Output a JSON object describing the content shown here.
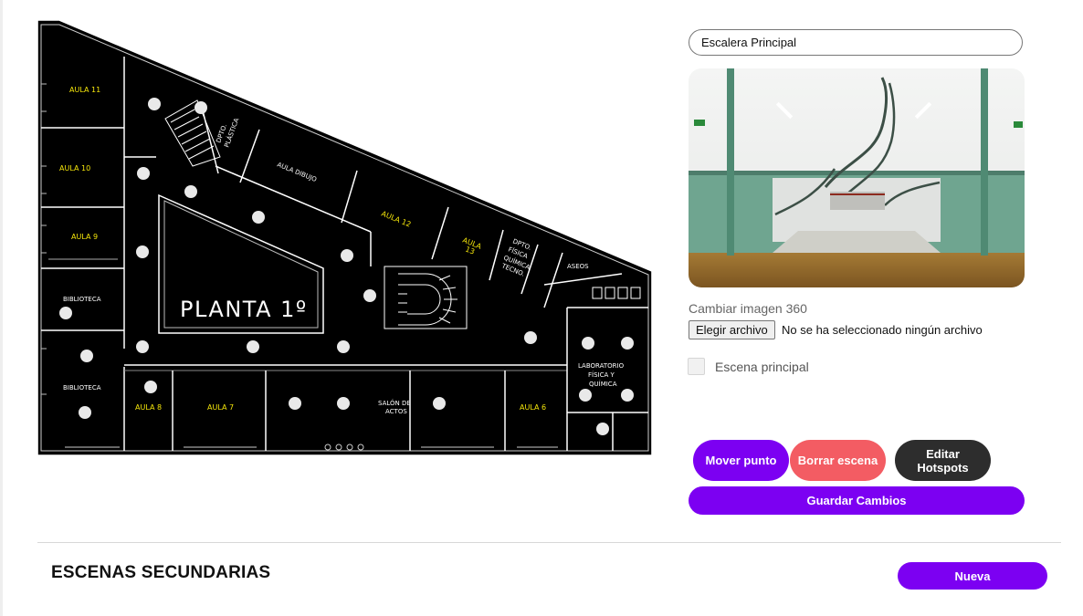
{
  "floorplan": {
    "title": "PLANTA 1º",
    "rooms": {
      "aula11": "AULA 11",
      "aula10": "AULA 10",
      "aula9": "AULA 9",
      "biblioteca1": "BIBLIOTECA",
      "biblioteca2": "BIBLIOTECA",
      "aula8": "AULA 8",
      "aula7": "AULA 7",
      "salon1": "SALÓN DE",
      "salon2": "ACTOS",
      "aula6": "AULA 6",
      "lab1": "LABORATORIO",
      "lab2": "FÍSICA Y",
      "lab3": "QUÍMICA",
      "aseos": "ASEOS",
      "aula12": "AULA 12",
      "aula13a": "AULA",
      "aula13b": "13",
      "dibujo": "AULA DIBUJO",
      "plastica1": "DPTO.",
      "plastica2": "PLÁSTICA",
      "fq1": "DPTO.",
      "fq2": "FÍSICA",
      "fq3": "QUÍMICA",
      "fq4": "TECNO."
    }
  },
  "scene": {
    "name": "Escalera Principal",
    "change_image_label": "Cambiar imagen 360",
    "file_button": "Elegir archivo",
    "file_status": "No se ha seleccionado ningún archivo",
    "main_scene_label": "Escena principal",
    "main_scene_checked": false
  },
  "actions": {
    "move": "Mover punto",
    "delete": "Borrar escena",
    "hotspots": "Editar Hotspots",
    "save": "Guardar Cambios"
  },
  "secondary": {
    "title": "ESCENAS SECUNDARIAS",
    "new_button": "Nueva"
  },
  "colors": {
    "accent": "#7c00f2",
    "danger": "#f35c63",
    "dark": "#2d2d2d",
    "room_label": "#f5e60a"
  }
}
